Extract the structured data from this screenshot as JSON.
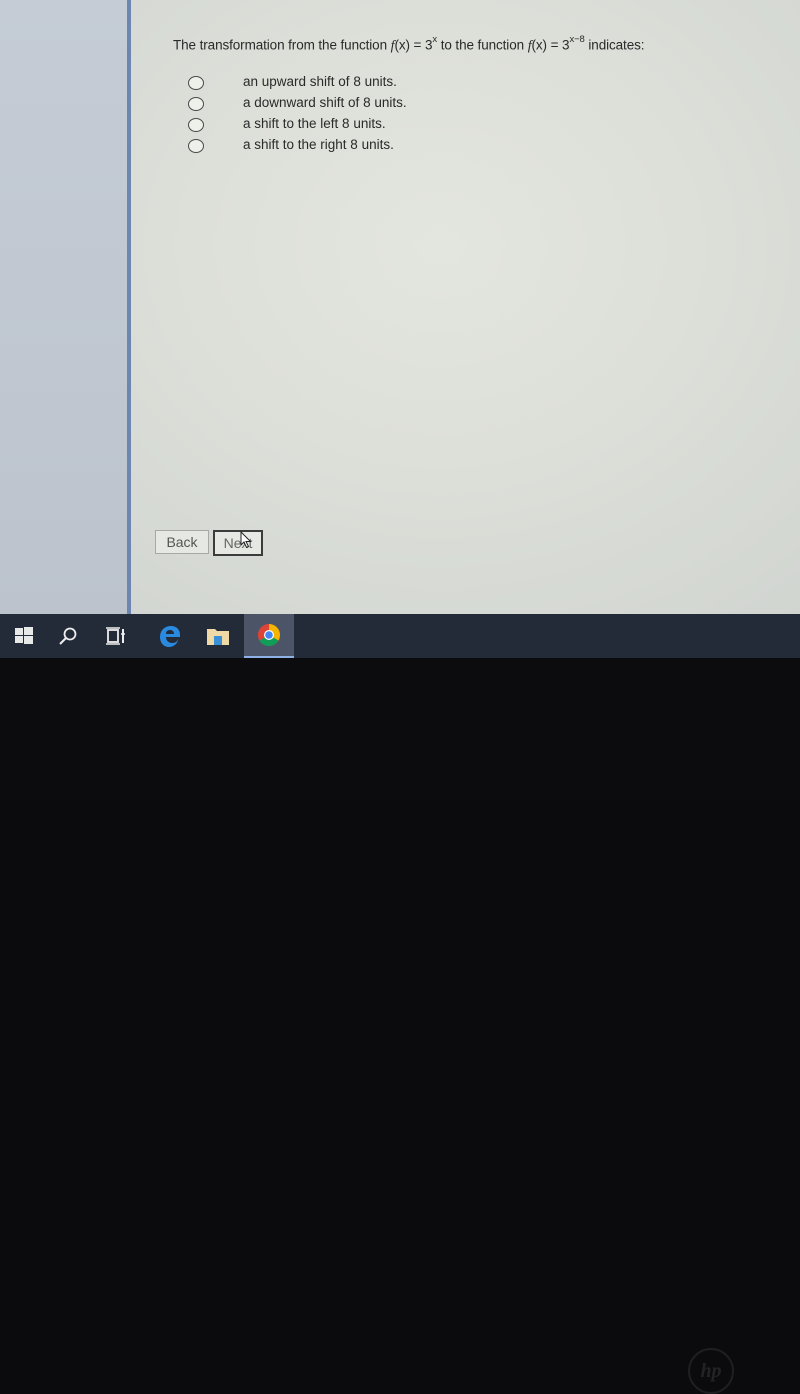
{
  "question": {
    "prefix": "The transformation from the function ",
    "func1_name": "f",
    "func1_arg": "(x)",
    "func1_eq": " = 3",
    "func1_exp": "x",
    "middle": " to the function ",
    "func2_name": "f",
    "func2_arg": "(x)",
    "func2_eq": " = 3",
    "func2_exp": "x−8",
    "suffix": " indicates:"
  },
  "options": [
    {
      "label": "an upward shift of 8 units.",
      "selected": false
    },
    {
      "label": "a downward shift of 8 units.",
      "selected": false
    },
    {
      "label": "a shift to the left 8 units.",
      "selected": false
    },
    {
      "label": "a shift to the right 8 units.",
      "selected": false
    }
  ],
  "buttons": {
    "back": "Back",
    "next": "Next"
  },
  "taskbar": {
    "items": [
      {
        "name": "start",
        "icon": "windows-logo-icon"
      },
      {
        "name": "search",
        "icon": "search-icon"
      },
      {
        "name": "task-view",
        "icon": "task-view-icon"
      },
      {
        "name": "edge",
        "icon": "edge-browser-icon"
      },
      {
        "name": "file-explorer",
        "icon": "folder-icon"
      },
      {
        "name": "chrome",
        "icon": "chrome-browser-icon",
        "active": true
      }
    ]
  },
  "colors": {
    "taskbar": "#232a38",
    "panel_border": "#6d86b0",
    "edge_blue": "#2a8ae0"
  },
  "bezel_logo": "hp"
}
